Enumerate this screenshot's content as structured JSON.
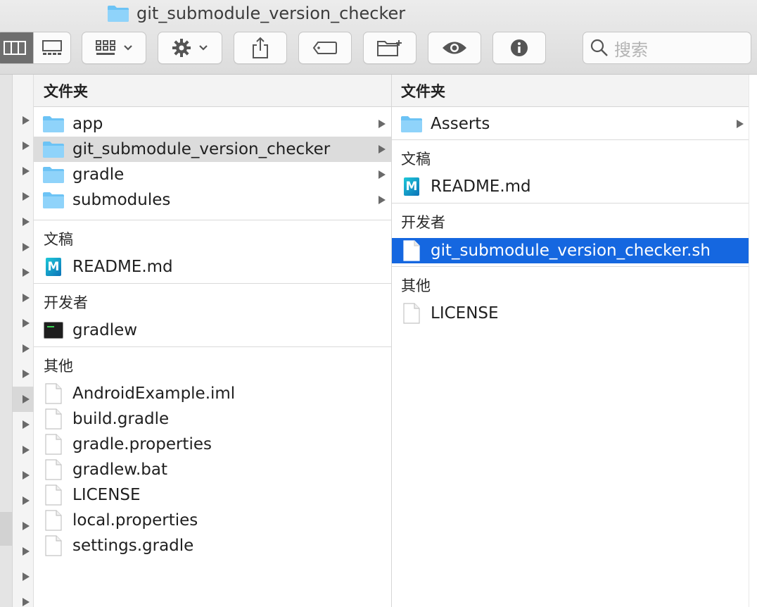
{
  "window": {
    "title": "git_submodule_version_checker"
  },
  "toolbar": {
    "search_placeholder": "搜索"
  },
  "left_column": {
    "header": "文件夹",
    "folders": [
      {
        "name": "app"
      },
      {
        "name": "git_submodule_version_checker",
        "selected": true
      },
      {
        "name": "gradle"
      },
      {
        "name": "submodules"
      }
    ],
    "groups": [
      {
        "label": "文稿",
        "items": [
          {
            "name": "README.md",
            "icon": "markdown-icon"
          }
        ]
      },
      {
        "label": "开发者",
        "items": [
          {
            "name": "gradlew",
            "icon": "terminal-icon"
          }
        ]
      },
      {
        "label": "其他",
        "items": [
          {
            "name": "AndroidExample.iml",
            "icon": "document-icon"
          },
          {
            "name": "build.gradle",
            "icon": "document-icon"
          },
          {
            "name": "gradle.properties",
            "icon": "document-icon"
          },
          {
            "name": "gradlew.bat",
            "icon": "document-icon"
          },
          {
            "name": "LICENSE",
            "icon": "document-icon"
          },
          {
            "name": "local.properties",
            "icon": "document-icon"
          },
          {
            "name": "settings.gradle",
            "icon": "document-icon"
          }
        ]
      }
    ]
  },
  "right_column": {
    "header": "文件夹",
    "folders": [
      {
        "name": "Asserts"
      }
    ],
    "groups": [
      {
        "label": "文稿",
        "items": [
          {
            "name": "README.md",
            "icon": "markdown-icon"
          }
        ]
      },
      {
        "label": "开发者",
        "items": [
          {
            "name": "git_submodule_version_checker.sh",
            "icon": "document-icon",
            "selected": true
          }
        ]
      },
      {
        "label": "其他",
        "items": [
          {
            "name": "LICENSE",
            "icon": "document-icon"
          }
        ]
      }
    ]
  },
  "colors": {
    "selection_blue": "#1567e0",
    "folder_blue": "#6cc3f5",
    "selection_grey": "#dcdcdc"
  }
}
